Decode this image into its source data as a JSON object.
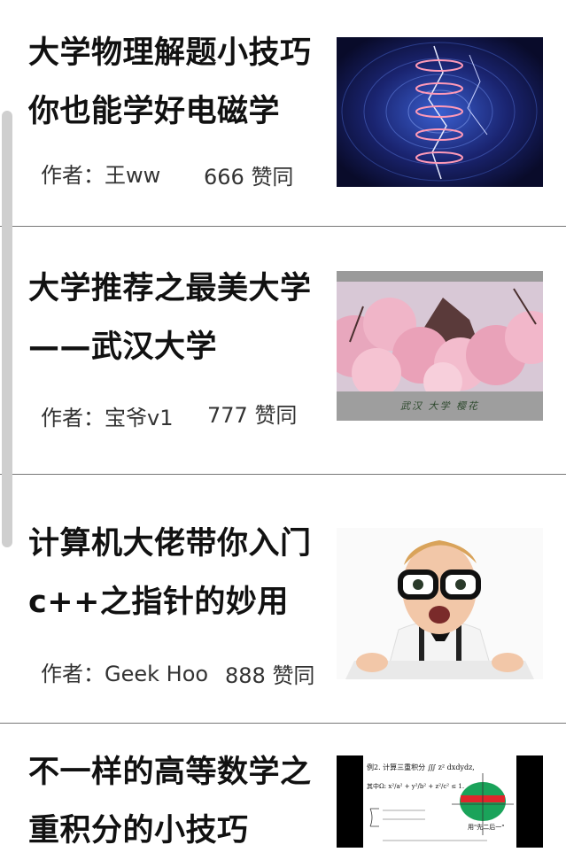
{
  "articles": [
    {
      "title_line1": "大学物理解题小技巧",
      "title_line2": "你也能学好电磁学",
      "author": "作者：王ww",
      "likes": "666 赞同",
      "thumbnail": "electromagnetic-coil-image"
    },
    {
      "title_line1": "大学推荐之最美大学",
      "title_line2": "——武汉大学",
      "author": "作者：宝爷v1",
      "likes": "777 赞同",
      "thumbnail": "cherry-blossom-image",
      "thumbnail_caption": "武汉 大学 樱花"
    },
    {
      "title_line1": "计算机大佬带你入门",
      "title_line2": "c++之指针的妙用",
      "author": "作者：Geek Hoo",
      "likes": "888 赞同",
      "thumbnail": "geek-with-glasses-image"
    },
    {
      "title_line1": "不一样的高等数学之",
      "title_line2": "重积分的小技巧",
      "thumbnail": "math-integral-image",
      "thumbnail_text": {
        "heading": "例2. 计算三重积分 ∭ z² dxdydz,",
        "line2": "其中Ω: x²/a² + y²/b² + z²/c² ≤ 1.",
        "hint": "用\"先二后一\""
      }
    }
  ],
  "colors": {
    "divider": "#777777",
    "scrollbar": "#cfcfcf"
  }
}
